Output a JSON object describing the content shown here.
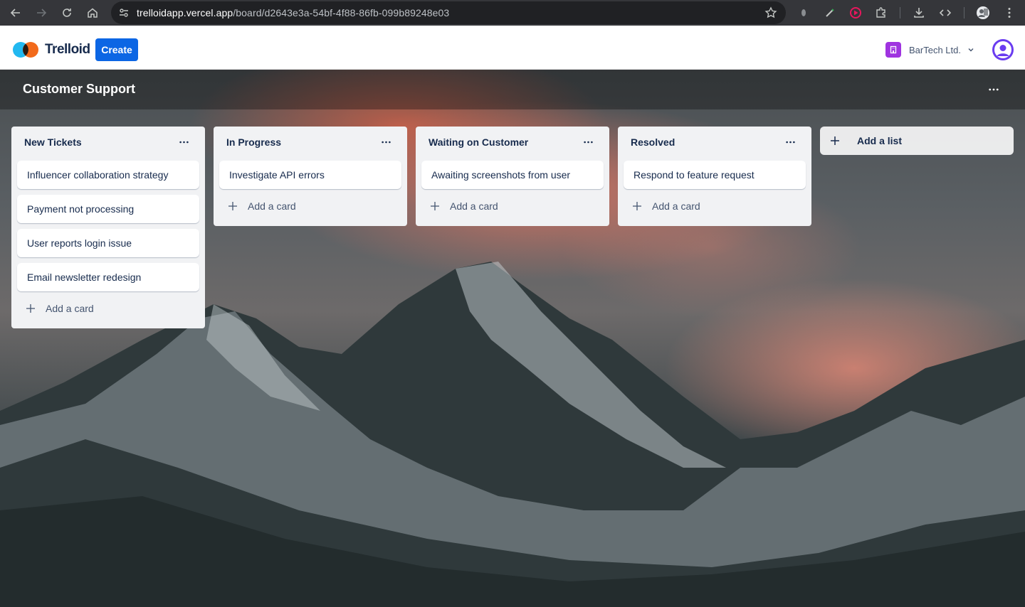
{
  "browser": {
    "url_host": "trelloidapp.vercel.app",
    "url_path": "/board/d2643e3a-54bf-4f88-86fb-099b89248e03"
  },
  "header": {
    "logo_text": "Trelloid",
    "create_label": "Create",
    "org_name": "BarTech Ltd."
  },
  "board": {
    "title": "Customer Support"
  },
  "lists": [
    {
      "title": "New Tickets",
      "cards": [
        "Influencer collaboration strategy",
        "Payment not processing",
        "User reports login issue",
        "Email newsletter redesign"
      ],
      "add_card_label": "Add a card"
    },
    {
      "title": "In Progress",
      "cards": [
        "Investigate API errors"
      ],
      "add_card_label": "Add a card"
    },
    {
      "title": "Waiting on Customer",
      "cards": [
        "Awaiting screenshots from user"
      ],
      "add_card_label": "Add a card"
    },
    {
      "title": "Resolved",
      "cards": [
        "Respond to feature request"
      ],
      "add_card_label": "Add a card"
    }
  ],
  "add_list_label": "Add a list",
  "colors": {
    "create_button": "#0c66e4",
    "org_icon": "#9f33e0",
    "avatar": "#6a3cf0",
    "list_bg": "#f1f2f4"
  }
}
